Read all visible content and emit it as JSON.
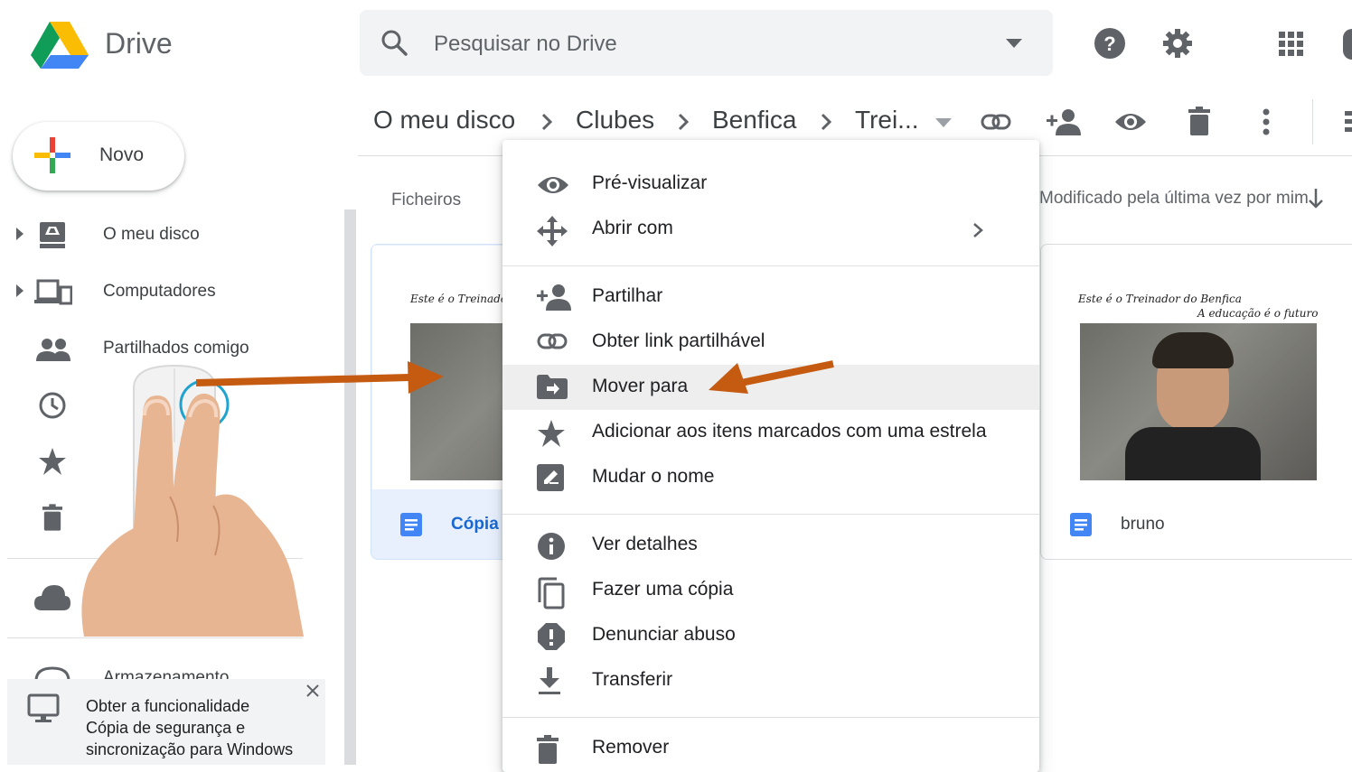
{
  "app": {
    "name": "Drive"
  },
  "search": {
    "placeholder": "Pesquisar no Drive"
  },
  "breadcrumb": [
    "O meu disco",
    "Clubes",
    "Benfica",
    "Trei..."
  ],
  "new_button": {
    "label": "Novo"
  },
  "sidebar": {
    "items": [
      {
        "label": "O meu disco",
        "icon": "drive-icon"
      },
      {
        "label": "Computadores",
        "icon": "computers-icon"
      },
      {
        "label": "Partilhados comigo",
        "icon": "people-icon"
      },
      {
        "label": "",
        "icon": "clock-icon"
      },
      {
        "label": "",
        "icon": "star-icon"
      },
      {
        "label": "",
        "icon": "trash-icon"
      },
      {
        "label": "",
        "icon": "cloud-icon"
      }
    ],
    "storage_label": "Armazenamento"
  },
  "promo": {
    "text": "Obter a funcionalidade Cópia de segurança e sincronização para Windows"
  },
  "content": {
    "files_label": "Ficheiros",
    "sort_label": "Modificado pela última vez por mim",
    "files": [
      {
        "name": "Cópia",
        "thumb_caption": "Este é o Treinador do Benfica",
        "selected": true
      },
      {
        "name": "bruno",
        "thumb_caption": "Este é o Treinador do Benfica",
        "thumb_subcaption": "A educação é o futuro",
        "selected": false
      }
    ]
  },
  "context_menu": {
    "items": [
      {
        "label": "Pré-visualizar",
        "icon": "eye-icon"
      },
      {
        "label": "Abrir com",
        "icon": "move-arrows-icon"
      },
      {
        "label": "Partilhar",
        "icon": "add-person-icon"
      },
      {
        "label": "Obter link partilhável",
        "icon": "link-icon"
      },
      {
        "label": "Mover para",
        "icon": "move-to-folder-icon",
        "highlighted": true
      },
      {
        "label": "Adicionar aos itens marcados com uma estrela",
        "icon": "star-icon"
      },
      {
        "label": "Mudar o nome",
        "icon": "edit-icon"
      },
      {
        "label": "Ver detalhes",
        "icon": "info-icon"
      },
      {
        "label": "Fazer uma cópia",
        "icon": "copy-icon"
      },
      {
        "label": "Denunciar abuso",
        "icon": "report-icon"
      },
      {
        "label": "Transferir",
        "icon": "download-icon"
      },
      {
        "label": "Remover",
        "icon": "trash-icon"
      }
    ]
  },
  "annotation": {
    "arrow_color": "#c55a11",
    "mouse_hint": "right-click-with-two-fingers"
  }
}
